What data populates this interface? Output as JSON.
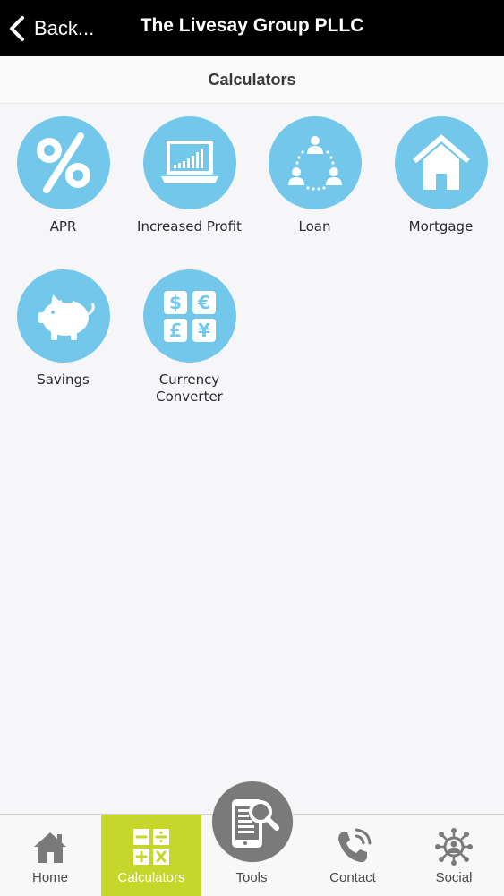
{
  "header": {
    "back_label": "Back...",
    "title": "The Livesay Group PLLC"
  },
  "subheader": {
    "title": "Calculators"
  },
  "tiles": [
    {
      "label": "APR",
      "icon": "percent-icon"
    },
    {
      "label": "Increased Profit",
      "icon": "laptop-chart-icon"
    },
    {
      "label": "Loan",
      "icon": "people-network-icon"
    },
    {
      "label": "Mortgage",
      "icon": "house-icon"
    },
    {
      "label": "Savings",
      "icon": "piggy-bank-icon"
    },
    {
      "label": "Currency\nConverter",
      "icon": "currency-icon"
    }
  ],
  "tabs": [
    {
      "label": "Home",
      "icon": "home-icon"
    },
    {
      "label": "Calculators",
      "icon": "calculator-icon",
      "active": true
    },
    {
      "label": "Tools",
      "icon": "tablet-search-icon"
    },
    {
      "label": "Contact",
      "icon": "phone-icon"
    },
    {
      "label": "Social",
      "icon": "social-network-icon"
    }
  ],
  "colors": {
    "header_bg": "#000000",
    "icon_circle": "#72c7ea",
    "active_tab": "#c6d62a",
    "page_bg": "#f6f6f8"
  }
}
